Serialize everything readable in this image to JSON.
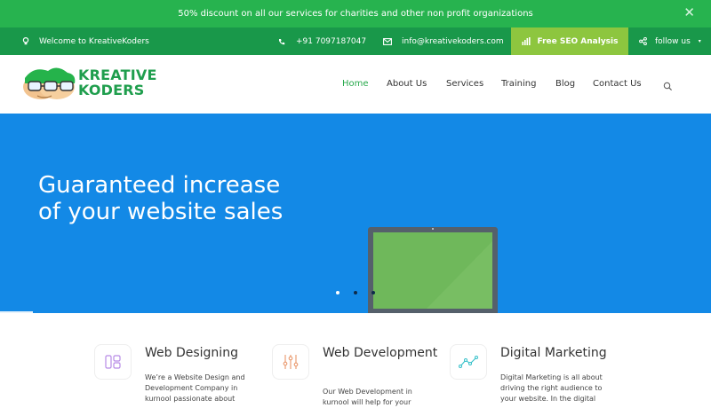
{
  "promo": {
    "text": "50% discount on all our services for charities and other non profit organizations",
    "close_glyph": "✕"
  },
  "topbar": {
    "welcome": "Welcome to KreativeKoders",
    "phone": "+91 7097187047",
    "email": "info@kreativekoders.com",
    "seo_label": "Free SEO Analysis",
    "follow_label": "follow us",
    "follow_arrow": "▾"
  },
  "logo": {
    "line1": "KREATIVE",
    "line2": "KODERS"
  },
  "nav": {
    "items": [
      "Home",
      "About Us",
      "Services",
      "Training",
      "Blog",
      "Contact Us"
    ],
    "active": "Home"
  },
  "hero": {
    "title_line1": "Guaranteed increase",
    "title_line2": "of your website sales",
    "slides": 3,
    "active_slide": 1
  },
  "services": [
    {
      "title": "Web Designing",
      "icon": "layout-icon",
      "text": "We’re a Website Design and Development Company in kurnool passionate about"
    },
    {
      "title": "Web Development",
      "icon": "sliders-icon",
      "text": "Our Web Development in kurnool will help for your"
    },
    {
      "title": "Digital Marketing",
      "icon": "trend-line-icon",
      "text": "Digital Marketing is all about driving the right audience to your website. In the digital"
    }
  ],
  "colors": {
    "promo": "#27b34f",
    "topbar": "#19984a",
    "seo_button": "#8dc63f",
    "hero": "#1389e6",
    "active_nav": "#27a94b"
  }
}
